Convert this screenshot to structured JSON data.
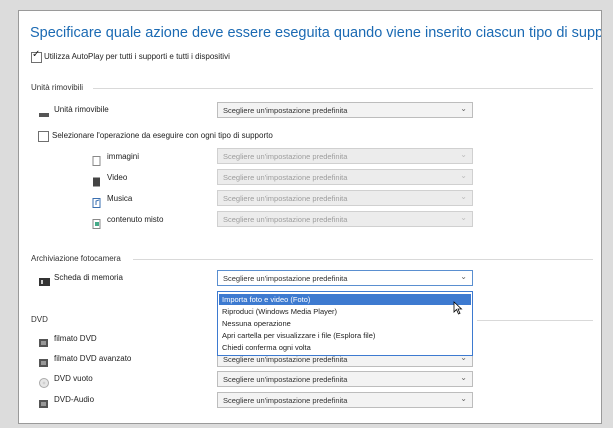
{
  "title": "Specificare quale azione deve essere eseguita quando viene inserito ciascun tipo di supporto o dispositivo",
  "autoplay_label": "Utilizza AutoPlay per tutti i supporti e tutti i dispositivi",
  "removable": {
    "section": "Unità rimovibili",
    "drive_label": "Unità rimovibile",
    "drive_value": "Scegliere un'impostazione predefinita",
    "per_type_label": "Selezionare l'operazione da eseguire con ogni tipo di supporto",
    "media": [
      {
        "label": "immagini",
        "value": "Scegliere un'impostazione predefinita"
      },
      {
        "label": "Video",
        "value": "Scegliere un'impostazione predefinita"
      },
      {
        "label": "Musica",
        "value": "Scegliere un'impostazione predefinita"
      },
      {
        "label": "contenuto misto",
        "value": "Scegliere un'impostazione predefinita"
      }
    ]
  },
  "camera": {
    "section": "Archiviazione fotocamera",
    "card_label": "Scheda di memoria",
    "card_value": "Scegliere un'impostazione predefinita",
    "options": [
      "Importa foto e video (Foto)",
      "Riproduci (Windows Media Player)",
      "Nessuna operazione",
      "Apri cartella per visualizzare i file (Esplora file)",
      "Chiedi conferma ogni volta"
    ]
  },
  "dvd": {
    "section": "DVD",
    "items": [
      {
        "label": "filmato DVD",
        "value": "Scegliere un'impostazione predefinita"
      },
      {
        "label": "filmato DVD avanzato",
        "value": "Scegliere un'impostazione predefinita"
      },
      {
        "label": "DVD vuoto",
        "value": "Scegliere un'impostazione predefinita"
      },
      {
        "label": "DVD-Audio",
        "value": "Scegliere un'impostazione predefinita"
      }
    ]
  },
  "colors": {
    "title": "#1b6ab3",
    "highlight": "#3d7ad0"
  }
}
